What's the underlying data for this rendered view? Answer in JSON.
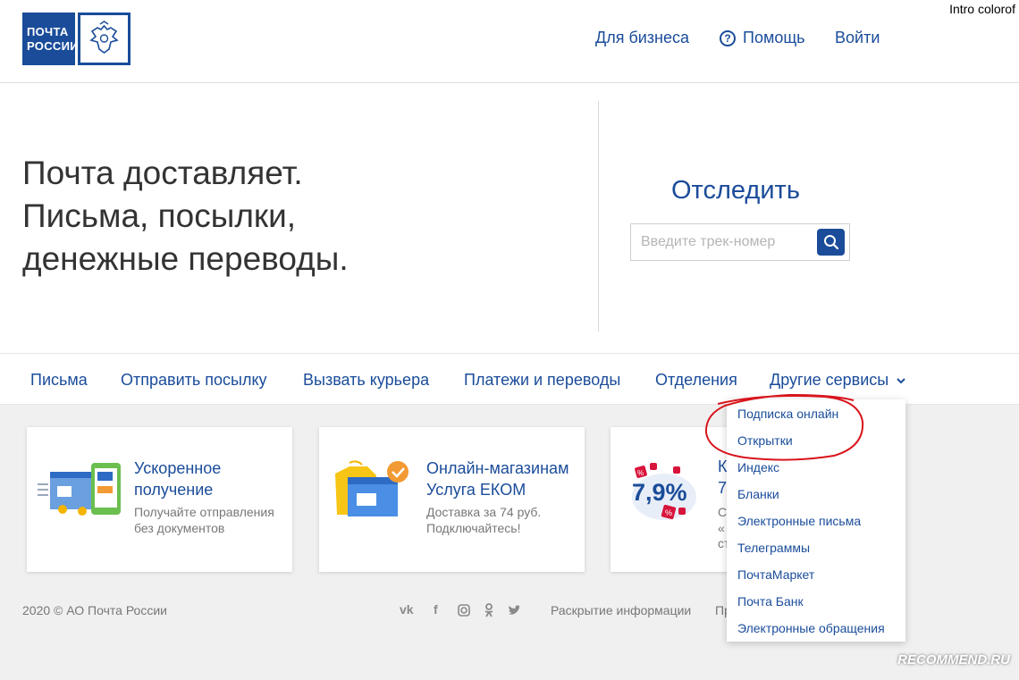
{
  "overlay_label": "Intro colorof",
  "logo": {
    "line1": "ПОЧТА",
    "line2": "РОССИИ"
  },
  "header_nav": {
    "business": "Для бизнеса",
    "help": "Помощь",
    "login": "Войти"
  },
  "hero": {
    "line1": "Почта доставляет.",
    "line2": "Письма, посылки,",
    "line3": "денежные переводы."
  },
  "tracking": {
    "title": "Отследить",
    "placeholder": "Введите трек-номер"
  },
  "category_nav": [
    "Письма",
    "Отправить посылку",
    "Вызвать курьера",
    "Платежи и переводы",
    "Отделения",
    "Другие сервисы"
  ],
  "cards": [
    {
      "title": "Ускоренное получение",
      "subtitle": "Получайте отправления без документов"
    },
    {
      "title": "Онлайн-магазинам Услуга ЕКОМ",
      "subtitle": "Доставка за 74 руб. Подключайтесь!"
    },
    {
      "title_partial": "К",
      "line2_partial": "7",
      "sub_partial1": "С",
      "sub_partial2": "«",
      "sub_partial3": "ст",
      "badge": "7,9%"
    }
  ],
  "dropdown": [
    "Подписка онлайн",
    "Открытки",
    "Индекс",
    "Бланки",
    "Электронные письма",
    "Телеграммы",
    "ПочтаМаркет",
    "Почта Банк",
    "Электронные обращения"
  ],
  "footer": {
    "copyright": "2020 © АО Почта России",
    "disclosure": "Раскрытие информации",
    "partial_link": "Пр"
  },
  "watermark": "RECOMMEND.RU",
  "colors": {
    "brand_blue": "#1a4c9a",
    "annotation_red": "#d8141c"
  }
}
